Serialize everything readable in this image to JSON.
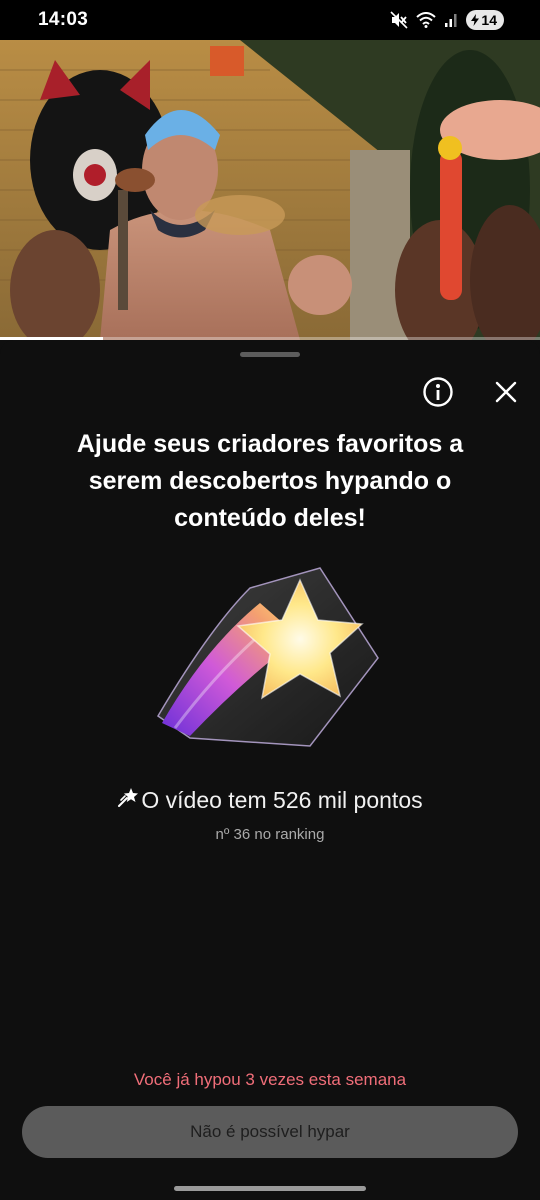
{
  "status_bar": {
    "time": "14:03",
    "battery": "14",
    "icons": [
      "mute-icon",
      "wifi-icon",
      "signal-icon",
      "battery-charging-icon"
    ]
  },
  "video": {
    "progress": 0.19
  },
  "sheet": {
    "headline": "Ajude seus criadores favoritos a serem descobertos hypando o conteúdo deles!",
    "points_icon": "shooting-star-icon",
    "points_text": "O vídeo tem 526 mil pontos",
    "ranking": "nº 36 no ranking",
    "warning": "Você já hypou 3 vezes esta semana",
    "button_label": "Não é possível hypar",
    "info_icon": "info-icon",
    "close_icon": "close-icon"
  },
  "colors": {
    "background": "#0f0f0f",
    "warning": "#f06e79",
    "button": "#5b5b5b"
  }
}
